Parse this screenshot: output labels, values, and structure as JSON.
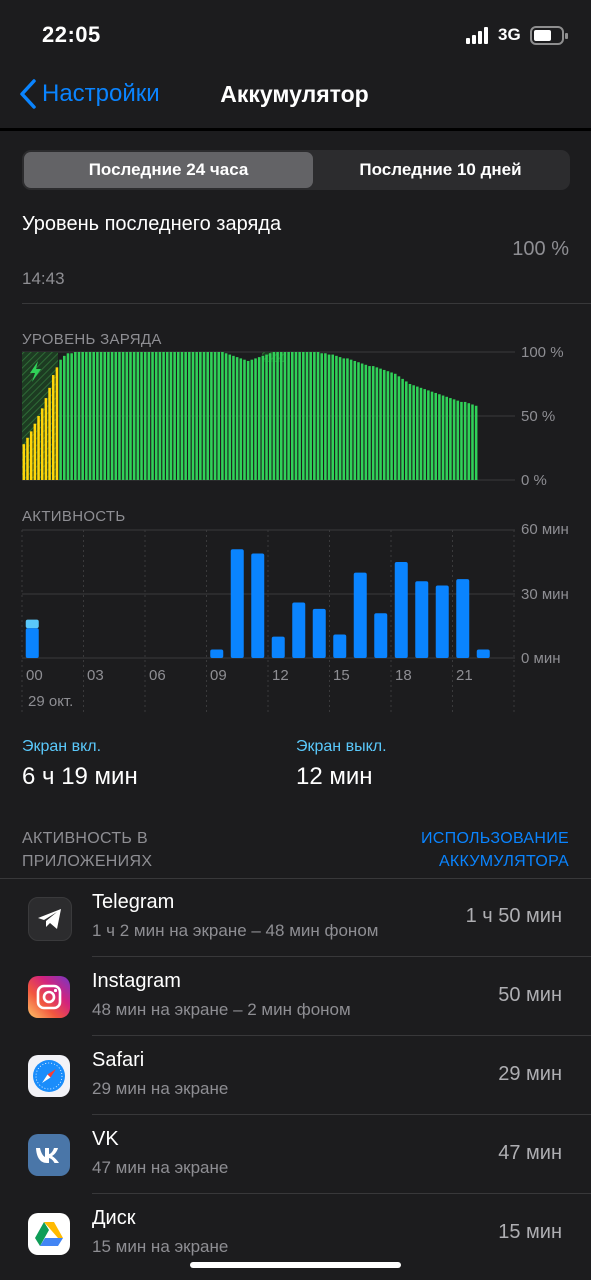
{
  "status_bar": {
    "time": "22:05",
    "network": "3G"
  },
  "nav": {
    "back_label": "Настройки",
    "title": "Аккумулятор"
  },
  "segmented": {
    "option_1": "Последние 24 часа",
    "option_2": "Последние 10 дней"
  },
  "last_charge": {
    "label": "Уровень последнего заряда",
    "time": "14:43",
    "value": "100 %"
  },
  "battery_chart": {
    "title": "УРОВЕНЬ ЗАРЯДА",
    "y_labels": [
      "100 %",
      "50 %",
      "0 %"
    ]
  },
  "activity_chart": {
    "title": "АКТИВНОСТЬ",
    "y_labels": [
      "60 мин",
      "30 мин",
      "0 мин"
    ],
    "x_labels": [
      "00",
      "03",
      "06",
      "09",
      "12",
      "15",
      "18",
      "21"
    ],
    "date_label": "29 окт."
  },
  "chart_data": [
    {
      "type": "bar",
      "title": "УРОВЕНЬ ЗАРЯДА",
      "ylim": [
        0,
        100
      ],
      "unit": "%",
      "values": [
        28,
        33,
        38,
        44,
        50,
        56,
        64,
        72,
        82,
        88,
        94,
        97,
        99,
        99,
        100,
        100,
        100,
        100,
        100,
        100,
        100,
        100,
        100,
        100,
        100,
        100,
        100,
        100,
        100,
        100,
        100,
        100,
        100,
        100,
        100,
        100,
        100,
        100,
        100,
        100,
        100,
        100,
        100,
        100,
        100,
        100,
        100,
        100,
        100,
        100,
        100,
        100,
        100,
        100,
        100,
        99,
        98,
        97,
        96,
        95,
        94,
        93,
        94,
        95,
        96,
        97,
        98,
        99,
        100,
        100,
        100,
        100,
        100,
        100,
        100,
        100,
        100,
        100,
        100,
        100,
        100,
        99,
        99,
        98,
        98,
        97,
        96,
        95,
        95,
        94,
        93,
        92,
        91,
        90,
        89,
        89,
        88,
        87,
        86,
        85,
        84,
        83,
        81,
        79,
        77,
        75,
        74,
        73,
        72,
        71,
        70,
        69,
        68,
        67,
        66,
        65,
        64,
        63,
        62,
        61,
        61,
        60,
        59,
        58
      ],
      "charging_bars": 10,
      "colors": {
        "charging": "#ffd60a",
        "normal": "#30d158"
      }
    },
    {
      "type": "bar",
      "title": "АКТИВНОСТЬ",
      "ylim": [
        0,
        60
      ],
      "unit": "мин",
      "categories": [
        "00",
        "01",
        "02",
        "03",
        "04",
        "05",
        "06",
        "07",
        "08",
        "09",
        "10",
        "11",
        "12",
        "13",
        "14",
        "15",
        "16",
        "17",
        "18",
        "19",
        "20",
        "21",
        "22",
        "23"
      ],
      "series": [
        {
          "values": [
            14,
            0,
            0,
            0,
            0,
            0,
            0,
            0,
            0,
            4,
            51,
            49,
            10,
            26,
            23,
            11,
            40,
            21,
            45,
            36,
            34,
            37,
            4,
            0
          ]
        },
        {
          "values": [
            4,
            0,
            0,
            0,
            0,
            0,
            0,
            0,
            0,
            0,
            0,
            0,
            0,
            0,
            0,
            0,
            0,
            0,
            0,
            0,
            0,
            0,
            0,
            0
          ]
        }
      ],
      "colors": {
        "screen_on": "#0a84ff",
        "screen_off": "#5ac8fa"
      }
    }
  ],
  "screen_on": {
    "label": "Экран вкл.",
    "value": "6 ч 19 мин"
  },
  "screen_off": {
    "label": "Экран выкл.",
    "value": "12 мин"
  },
  "apps_section": {
    "left_line1": "АКТИВНОСТЬ В",
    "left_line2": "ПРИЛОЖЕНИЯХ",
    "right_line1": "ИСПОЛЬЗОВАНИЕ",
    "right_line2": "АККУМУЛЯТОРА"
  },
  "apps": [
    {
      "name": "Telegram",
      "detail": "1 ч 2 мин на экране – 48 мин фоном",
      "time": "1 ч 50 мин",
      "icon": "telegram-icon"
    },
    {
      "name": "Instagram",
      "detail": "48 мин на экране – 2 мин фоном",
      "time": "50 мин",
      "icon": "instagram-icon"
    },
    {
      "name": "Safari",
      "detail": "29 мин на экране",
      "time": "29 мин",
      "icon": "safari-icon"
    },
    {
      "name": "VK",
      "detail": "47 мин на экране",
      "time": "47 мин",
      "icon": "vk-icon"
    },
    {
      "name": "Диск",
      "detail": "15 мин на экране",
      "time": "15 мин",
      "icon": "drive-icon"
    }
  ]
}
